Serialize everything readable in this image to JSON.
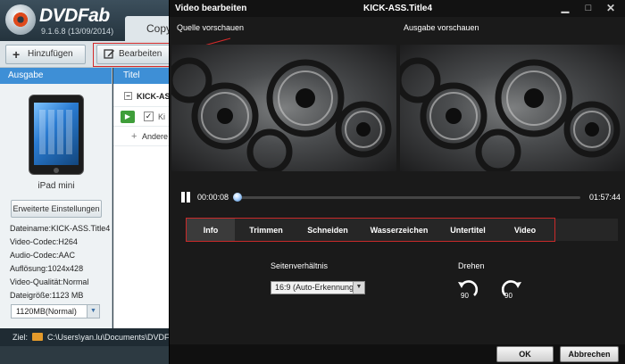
{
  "app": {
    "brand": "DVDFab",
    "version": "9.1.6.8 (13/09/2014)",
    "active_tab": "Copy"
  },
  "toolbar": {
    "add_label": "Hinzufügen",
    "edit_label": "Bearbeiten"
  },
  "left_panel": {
    "header": "Ausgabe",
    "device_name": "iPad mini",
    "advanced_button": "Erweiterte Einstellungen",
    "info": [
      "Dateiname:KICK-ASS.Title4",
      "Video-Codec:H264",
      "Audio-Codec:AAC",
      "Auflösung:1024x428",
      "Video-Qualität:Normal",
      "Dateigröße:1123 MB"
    ],
    "size_select": "1120MB(Normal)"
  },
  "middle_panel": {
    "header": "Titel",
    "title_row": "KICK-ASS",
    "track_label": "Ki",
    "other_row": "Andere"
  },
  "bottom": {
    "ziel_label": "Ziel:",
    "path": "C:\\Users\\yan.lu\\Documents\\DVDFab"
  },
  "dialog": {
    "title_left": "Video bearbeiten",
    "title_center": "KICK-ASS.Title4",
    "source_label": "Quelle vorschauen",
    "output_label": "Ausgabe vorschauen",
    "time_current": "00:00:08",
    "time_total": "01:57:44",
    "progress": 0.005,
    "tabs": [
      "Info",
      "Trimmen",
      "Schneiden",
      "Wasserzeichen",
      "Untertitel",
      "Video"
    ],
    "active_tab": 0,
    "aspect_label": "Seitenverhältnis",
    "aspect_value": "16:9 (Auto-Erkennung)",
    "rotate_label": "Drehen",
    "rotate_left": "90",
    "rotate_right": "90",
    "ok_label": "OK",
    "cancel_label": "Abbrechen"
  },
  "colors": {
    "accent_blue": "#3e8fd6",
    "highlight_red": "#d42a2a",
    "play_green": "#3f9e3a",
    "dialog_bg": "#1a1a1a"
  },
  "icons": {
    "add": "plus-icon",
    "edit": "edit-icon",
    "play": "play-icon",
    "pause": "pause-icon",
    "rotate_left": "rotate-left-icon",
    "rotate_right": "rotate-right-icon",
    "folder": "folder-icon",
    "minimize": "minimize-icon",
    "maximize": "maximize-icon",
    "close": "close-icon"
  }
}
